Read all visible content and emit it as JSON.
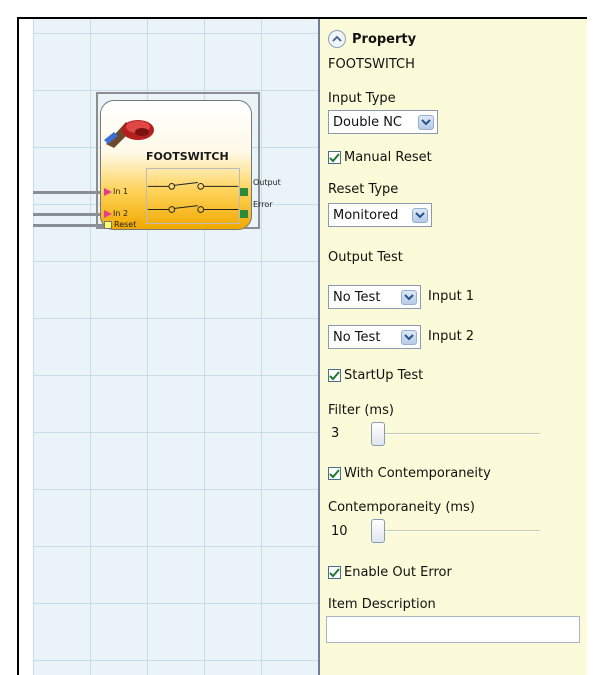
{
  "canvas": {
    "block": {
      "title": "FOOTSWITCH",
      "inputs": [
        "In 1",
        "In 2",
        "Reset"
      ],
      "outputs": [
        "Output",
        "Error"
      ]
    }
  },
  "panel": {
    "header": "Property",
    "component_name": "FOOTSWITCH",
    "input_type": {
      "label": "Input Type",
      "value": "Double NC"
    },
    "manual_reset": {
      "label": "Manual Reset",
      "checked": true
    },
    "reset_type": {
      "label": "Reset Type",
      "value": "Monitored"
    },
    "output_test": {
      "label": "Output Test",
      "input1": {
        "value": "No Test",
        "label": "Input 1"
      },
      "input2": {
        "value": "No Test",
        "label": "Input 2"
      }
    },
    "startup_test": {
      "label": "StartUp Test",
      "checked": true
    },
    "filter": {
      "label": "Filter (ms)",
      "value": "3"
    },
    "with_contemporaneity": {
      "label": "With Contemporaneity",
      "checked": true
    },
    "contemporaneity": {
      "label": "Contemporaneity (ms)",
      "value": "10"
    },
    "enable_out_error": {
      "label": "Enable Out Error",
      "checked": true
    },
    "item_description": {
      "label": "Item Description",
      "value": ""
    }
  },
  "colors": {
    "panel_bg": "#fbfbd9",
    "canvas_bg": "#e9f3f8",
    "grid": "#c8dce8",
    "block_gradient_end": "#f0a800",
    "input_arrow": "#e63c8c",
    "output_port": "#2b8a3e",
    "reset_port": "#ffff66"
  },
  "icons": [
    "chevron-up-icon",
    "chevron-down-icon",
    "check-icon",
    "footswitch-pedal-icon",
    "switch-contacts-icon"
  ]
}
